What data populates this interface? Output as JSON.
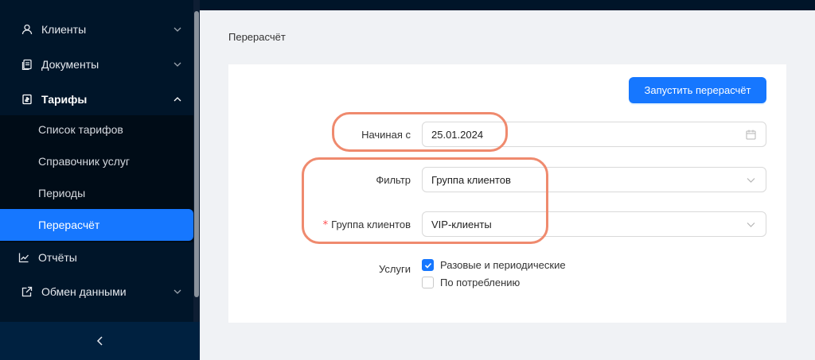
{
  "sidebar": {
    "items": [
      {
        "label": "Клиенты",
        "icon": "user-icon"
      },
      {
        "label": "Документы",
        "icon": "documents-icon"
      },
      {
        "label": "Тарифы",
        "icon": "tariff-icon",
        "open": true
      },
      {
        "label": "Отчёты",
        "icon": "chart-icon"
      },
      {
        "label": "Обмен данными",
        "icon": "data-exchange-icon"
      }
    ],
    "subitems": [
      {
        "label": "Список тарифов"
      },
      {
        "label": "Справочник услуг"
      },
      {
        "label": "Периоды"
      },
      {
        "label": "Перерасчёт",
        "active": true
      }
    ],
    "collapse_icon": "chevron-left-icon"
  },
  "page": {
    "title": "Перерасчёт"
  },
  "form": {
    "run_button": "Запустить перерасчёт",
    "start_label": "Начиная с",
    "start_value": "25.01.2024",
    "filter_label": "Фильтр",
    "filter_value": "Группа клиентов",
    "group_required_mark": "*",
    "group_label": "Группа клиентов",
    "group_value": "VIP-клиенты",
    "services_label": "Услуги",
    "services": [
      {
        "label": "Разовые и периодические",
        "checked": true
      },
      {
        "label": "По потреблению",
        "checked": false
      }
    ]
  },
  "colors": {
    "sidebar_bg": "#001529",
    "accent": "#1677ff",
    "highlight": "#ef8a6e"
  }
}
